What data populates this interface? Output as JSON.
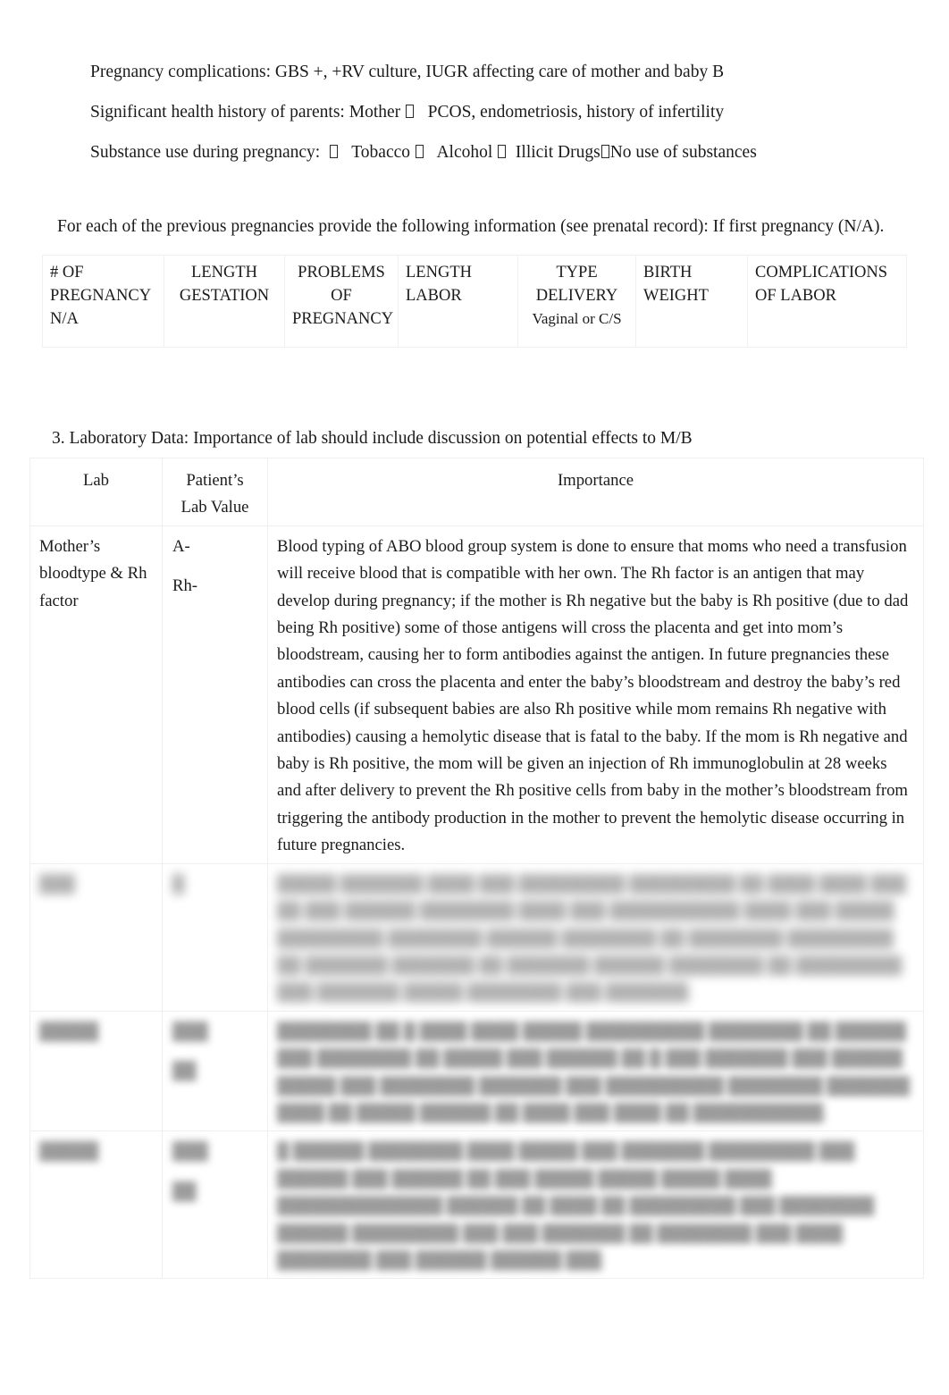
{
  "document": {
    "intro": {
      "lines": [
        {
          "id": "pregnancy-complications",
          "segments": [
            {
              "type": "text",
              "value": "Pregnancy complications: GBS +, +RV culture, IUGR affecting care of mother and baby B"
            }
          ]
        },
        {
          "id": "parent-health-history",
          "segments": [
            {
              "type": "text",
              "value": "Significant health history of parents: Mother "
            },
            {
              "type": "tofu"
            },
            {
              "type": "text",
              "value": "   PCOS, endometriosis, history of infertility"
            }
          ]
        },
        {
          "id": "substance-use",
          "segments": [
            {
              "type": "text",
              "value": "Substance use during pregnancy:  "
            },
            {
              "type": "tofu"
            },
            {
              "type": "text",
              "value": "   Tobacco "
            },
            {
              "type": "tofu"
            },
            {
              "type": "text",
              "value": "   Alcohol "
            },
            {
              "type": "tofu"
            },
            {
              "type": "text",
              "value": "  Illicit Drugs"
            },
            {
              "type": "tofu"
            },
            {
              "type": "text",
              "value": "No use of substances"
            }
          ]
        }
      ]
    },
    "prenatal_prompt": "For each of the previous pregnancies provide the following information (see prenatal record): If first pregnancy (N/A).",
    "pregnancy_table": {
      "headers": [
        {
          "id": "num-pregnancy",
          "lines": [
            "# OF",
            "PREGNANCY",
            "N/A"
          ],
          "align": "left"
        },
        {
          "id": "length-gestation",
          "lines": [
            "LENGTH",
            "GESTATION"
          ],
          "align": "center"
        },
        {
          "id": "problems-pregnancy",
          "lines": [
            "PROBLEMS OF",
            "PREGNANCY"
          ],
          "align": "center"
        },
        {
          "id": "length-labor",
          "lines": [
            "LENGTH",
            "LABOR"
          ],
          "align": "left"
        },
        {
          "id": "type-delivery",
          "lines": [
            "TYPE",
            "DELIVERY"
          ],
          "sub": "Vaginal or C/S",
          "align": "center"
        },
        {
          "id": "birth-weight",
          "lines": [
            "BIRTH",
            "WEIGHT"
          ],
          "align": "left"
        },
        {
          "id": "complications-labor",
          "lines": [
            "COMPLICATIONS",
            "OF LABOR"
          ],
          "align": "left"
        }
      ]
    },
    "lab_section": {
      "heading": "3. Laboratory Data:  Importance of lab should include discussion on potential effects to M/B",
      "headers": {
        "lab": [
          "Lab"
        ],
        "patient_value": [
          "Patient’s",
          "Lab Value"
        ],
        "importance": [
          "Importance"
        ]
      },
      "rows": [
        {
          "id": "mothers-blood-type-rh",
          "lab": [
            "Mother’s blood",
            "type & Rh factor"
          ],
          "value": [
            "A-",
            "Rh-"
          ],
          "importance": "Blood typing of ABO blood group system is done to ensure that moms who need a transfusion will receive blood that is compatible with her own. The Rh factor is an antigen that may develop during pregnancy; if the mother is Rh negative but the baby is Rh positive (due to dad being Rh positive) some of those antigens will cross the placenta and get into mom’s bloodstream, causing her to form antibodies against the antigen. In future pregnancies these antibodies can cross the placenta and enter the baby’s bloodstream and destroy the baby’s red blood cells (if subsequent babies are also Rh positive while mom remains Rh negative with antibodies) causing a hemolytic disease that is fatal to the baby. If the mom is Rh negative and baby is Rh positive, the mom will be given an injection of Rh immunoglobulin at 28 weeks and after delivery to prevent the Rh positive cells from baby in the mother’s bloodstream from triggering the antibody production in the mother to prevent the hemolytic disease occurring in future pregnancies.",
          "redacted": false
        },
        {
          "id": "redacted-row-1",
          "lab": [
            "███"
          ],
          "value": [
            "█"
          ],
          "importance": "█████ ███████ ████ ███ █████████ █████████ ██ ████ ████ ███ ██ ███ ██████ ████████ ████ ███ ███████████ ████ ███ █████ █████████ ████████ ██████ ████████ ██ ████████ █████████ ██ ███████ ███████ ██ ███████ ██████ ████████ ██ █████████ ███ ███████ █████ ████████ ███ ███████.",
          "redacted": true,
          "heavy": true
        },
        {
          "id": "redacted-row-2",
          "lab": [
            "█████"
          ],
          "value": [
            "███",
            "██"
          ],
          "importance": "████████ ██ █ ████ ████ █████ ██████████ ████████ ██ ██████ ███ ████████ ██ █████ ███ ██████ ██ █ ███ ███████ ███ ██████ █████ ███ ████████ ███████ ███ ██████████ ████████ ███████ ████ ██ █████ ██████ ██ ████ ███ ████ ██ ███████████.",
          "redacted": true,
          "heavy": false
        },
        {
          "id": "redacted-row-3",
          "lab": [
            "█████"
          ],
          "value": [
            "███",
            "██"
          ],
          "importance": "█ ██████ ████████ ████ █████ ███ ███████ █████████ ███ ██████ ███ ██████ ██ ███ █████ █████ █████ ████ ██████████████ ██████ ██ ████ ██ █████████ ███ ████████ ██████ █████████ ███ ███ ███████ ██ ████████ ███ ████ ████████ ███ ██████ ██████ ███.",
          "redacted": true,
          "heavy": false
        }
      ]
    }
  }
}
